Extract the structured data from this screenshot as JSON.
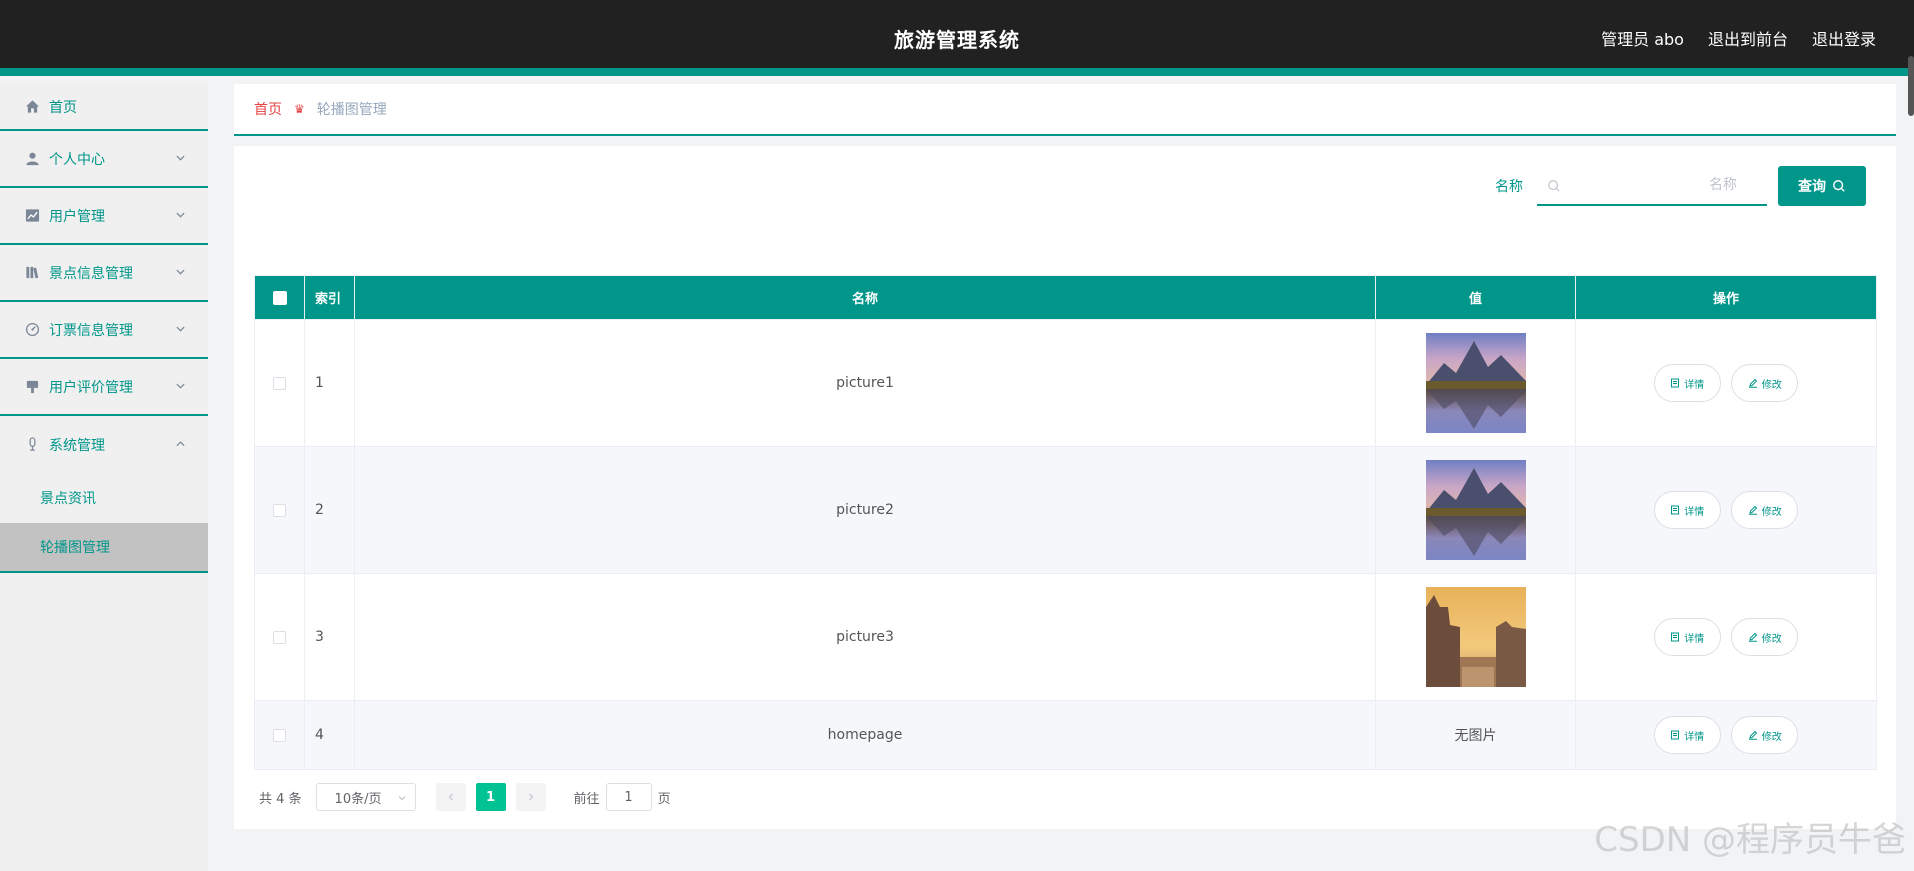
{
  "header": {
    "title": "旅游管理系统",
    "admin_label": "管理员 abo",
    "frontend_label": "退出到前台",
    "logout_label": "退出登录"
  },
  "sidebar": {
    "items": [
      {
        "label": "首页",
        "icon": "home-icon"
      },
      {
        "label": "个人中心",
        "icon": "user-icon"
      },
      {
        "label": "用户管理",
        "icon": "chart-icon"
      },
      {
        "label": "景点信息管理",
        "icon": "library-icon"
      },
      {
        "label": "订票信息管理",
        "icon": "gauge-icon"
      },
      {
        "label": "用户评价管理",
        "icon": "brush-icon"
      },
      {
        "label": "系统管理",
        "icon": "microphone-icon"
      }
    ],
    "sub_items": [
      {
        "label": "景点资讯"
      },
      {
        "label": "轮播图管理"
      }
    ]
  },
  "breadcrumb": {
    "home": "首页",
    "current": "轮播图管理"
  },
  "search": {
    "label": "名称",
    "placeholder": "名称",
    "button": "查询"
  },
  "table": {
    "headers": [
      "索引",
      "名称",
      "值",
      "操作"
    ],
    "rows": [
      {
        "index": "1",
        "name": "picture1",
        "value": "image"
      },
      {
        "index": "2",
        "name": "picture2",
        "value": "image"
      },
      {
        "index": "3",
        "name": "picture3",
        "value": "image"
      },
      {
        "index": "4",
        "name": "homepage",
        "value": "无图片"
      }
    ],
    "detail_label": "详情",
    "edit_label": "修改"
  },
  "pagination": {
    "total": "共 4 条",
    "page_size": "10条/页",
    "current_page": "1",
    "goto_label": "前往",
    "jump_value": "1",
    "page_unit": "页"
  },
  "watermark": "CSDN @程序员牛爸",
  "colors": {
    "accent": "#00968a",
    "header_bg": "#212121",
    "breadcrumb_home": "#e64242",
    "page_active": "#00c292"
  }
}
